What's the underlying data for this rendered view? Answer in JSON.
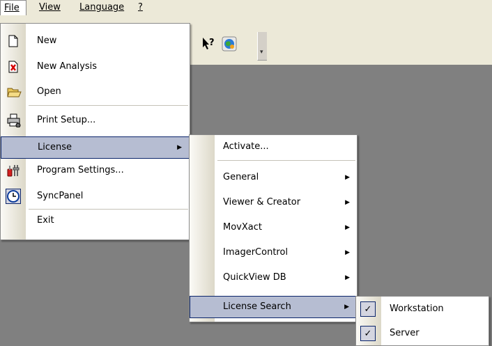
{
  "menubar": {
    "file": "File",
    "view": "View",
    "language": "Language",
    "help": "?"
  },
  "file_menu": {
    "items": [
      {
        "label": "New",
        "icon": "new-document-icon"
      },
      {
        "label": "New Analysis",
        "icon": "new-analysis-icon"
      },
      {
        "label": "Open",
        "icon": "open-folder-icon"
      },
      {
        "label": "Print Setup...",
        "icon": "printer-icon"
      },
      {
        "label": "License",
        "icon": ""
      },
      {
        "label": "Program Settings...",
        "icon": "settings-tools-icon"
      },
      {
        "label": "SyncPanel",
        "icon": "clock-icon"
      },
      {
        "label": "Exit",
        "icon": ""
      }
    ]
  },
  "license_menu": {
    "items": [
      "Activate...",
      "General",
      "Viewer & Creator",
      "MovXact",
      "ImagerControl",
      "QuickView DB",
      "License Search"
    ]
  },
  "search_menu": {
    "items": [
      {
        "label": "Workstation",
        "checked": true
      },
      {
        "label": "Server",
        "checked": true
      }
    ]
  },
  "colors": {
    "highlight": "#b6bdd2",
    "highlight_border": "#0a246a",
    "workspace": "#808080",
    "chrome": "#ece9d8"
  }
}
